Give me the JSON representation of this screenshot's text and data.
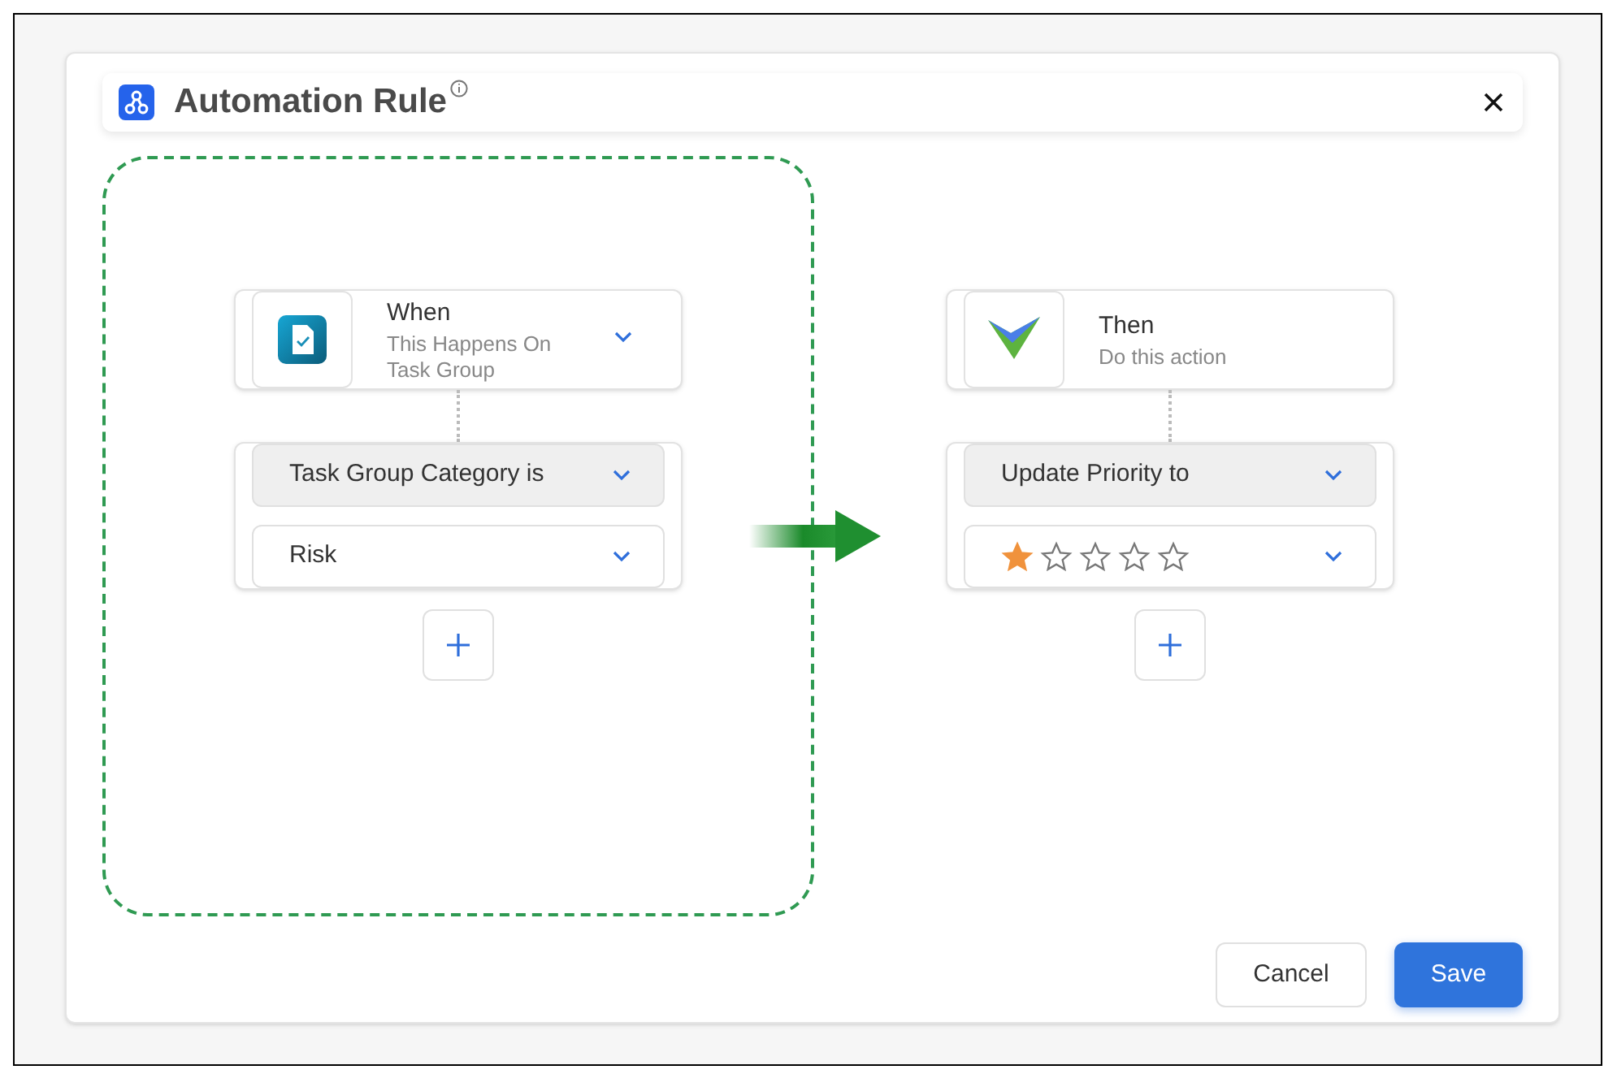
{
  "dialog": {
    "title": "Automation Rule",
    "info_icon": true
  },
  "trigger": {
    "title": "When",
    "subtitle": "This Happens On Task Group",
    "conditions": [
      {
        "kind": "field",
        "label": "Task Group Category is"
      },
      {
        "kind": "value",
        "label": "Risk"
      }
    ]
  },
  "action": {
    "title": "Then",
    "subtitle": "Do this action",
    "steps": [
      {
        "kind": "field",
        "label": "Update Priority to"
      },
      {
        "kind": "rating",
        "stars": 1
      }
    ]
  },
  "buttons": [
    {
      "kind": "secondary",
      "label": "Cancel"
    },
    {
      "kind": "primary",
      "label": "Save"
    }
  ]
}
